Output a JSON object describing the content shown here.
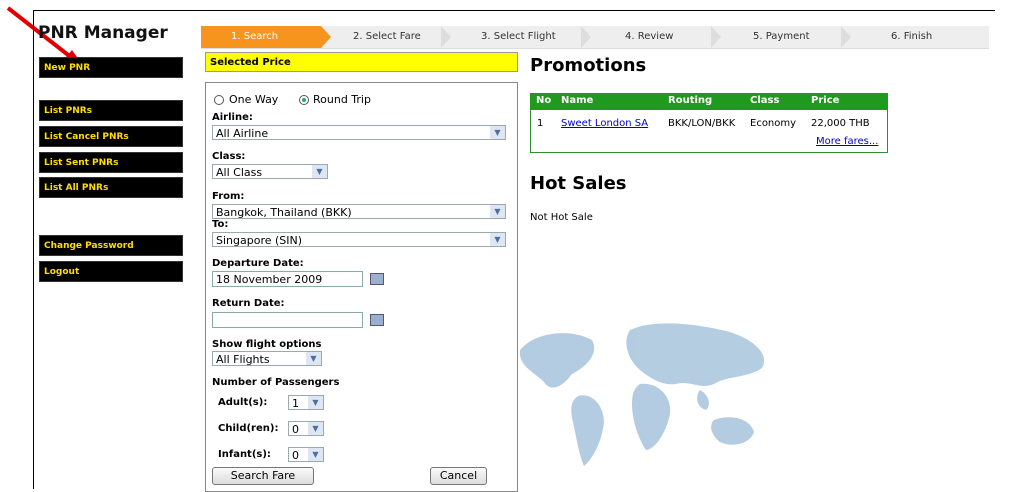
{
  "app": {
    "title": "PNR Manager"
  },
  "sidebar": {
    "items": [
      {
        "label": "New PNR"
      },
      {
        "label": "List PNRs"
      },
      {
        "label": "List Cancel PNRs"
      },
      {
        "label": "List Sent PNRs"
      },
      {
        "label": "List All PNRs"
      },
      {
        "label": "Change Password"
      },
      {
        "label": "Logout"
      }
    ]
  },
  "steps": [
    {
      "label": "1. Search",
      "active": true
    },
    {
      "label": "2. Select Fare"
    },
    {
      "label": "3. Select Flight"
    },
    {
      "label": "4. Review"
    },
    {
      "label": "5. Payment"
    },
    {
      "label": "6. Finish"
    }
  ],
  "search": {
    "panel_title": "Selected Price",
    "trip": {
      "one_way": "One Way",
      "round_trip": "Round Trip",
      "selected": "Round Trip"
    },
    "airline_label": "Airline:",
    "airline_value": "All Airline",
    "class_label": "Class:",
    "class_value": "All Class",
    "from_label": "From:",
    "from_value": "Bangkok, Thailand (BKK)",
    "to_label": "To:",
    "to_value": "Singapore (SIN)",
    "departure_label": "Departure Date:",
    "departure_value": "18 November 2009",
    "return_label": "Return Date:",
    "return_value": "",
    "flight_options_label": "Show flight options",
    "flight_options_value": "All Flights",
    "passengers_label": "Number of Passengers",
    "adult_label": "Adult(s):",
    "adult_value": "1",
    "child_label": "Child(ren):",
    "child_value": "0",
    "infant_label": "Infant(s):",
    "infant_value": "0",
    "search_button": "Search Fare",
    "cancel_button": "Cancel"
  },
  "promotions": {
    "heading": "Promotions",
    "columns": [
      "No",
      "Name",
      "Routing",
      "Class",
      "Price"
    ],
    "rows": [
      {
        "no": "1",
        "name": "Sweet London SA",
        "routing": "BKK/LON/BKK",
        "class": "Economy",
        "price": "22,000 THB"
      }
    ],
    "more_link": "More fares..."
  },
  "hot_sales": {
    "heading": "Hot Sales",
    "text": "Not Hot Sale"
  },
  "colors": {
    "sidebar_bg": "#000000",
    "sidebar_text": "#ffde00",
    "active_step": "#f7941d",
    "promo_header": "#1f9a1f",
    "selected_price_bg": "#ffff00"
  }
}
